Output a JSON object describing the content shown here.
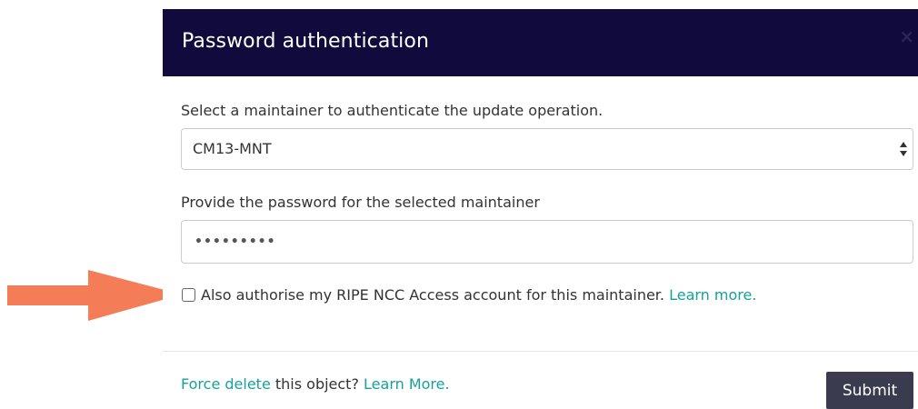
{
  "modal": {
    "title": "Password authentication",
    "close_icon": "×"
  },
  "maintainer": {
    "label": "Select a maintainer to authenticate the update operation.",
    "selected": "CM13-MNT",
    "arrow_icon": "up-down-caret-icon"
  },
  "password": {
    "label": "Provide the password for the selected maintainer",
    "value": "•••••••••"
  },
  "authorise": {
    "checked": false,
    "label": "Also authorise my RIPE NCC Access account for this maintainer.",
    "learn_more": "Learn more."
  },
  "footer": {
    "force_delete_link": "Force delete",
    "question_text": " this object? ",
    "learn_more": "Learn More.",
    "submit_label": "Submit"
  },
  "colors": {
    "header_bg": "#100b3c",
    "link": "#14a29c",
    "submit_bg": "#3b3b4f",
    "annotation_arrow": "#f47c56"
  }
}
